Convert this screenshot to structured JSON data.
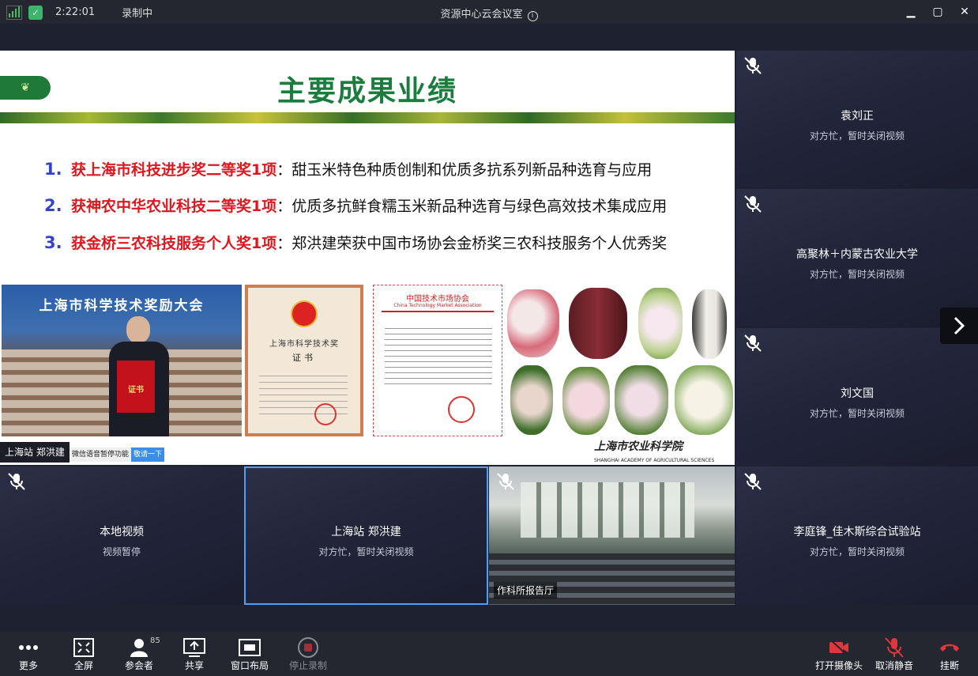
{
  "status_bar": {
    "time": "2:22:01",
    "recording": "录制中",
    "title": "资源中心云会议室",
    "info_icon": "info-icon"
  },
  "window_controls": [
    "minimize-icon",
    "maximize-icon",
    "close-icon"
  ],
  "shared_slide": {
    "title": "主要成果业绩",
    "achievements": [
      {
        "num": "1.",
        "award": "获上海市科技进步奖二等奖1项",
        "desc": "甜玉米特色种质创制和优质多抗系列新品种选育与应用"
      },
      {
        "num": "2.",
        "award": "获神农中华农业科技二等奖1项",
        "desc": "优质多抗鲜食糯玉米新品种选育与绿色高效技术集成应用"
      },
      {
        "num": "3.",
        "award": "获金桥三农科技服务个人奖1项",
        "desc": "郑洪建荣获中国市场协会金桥奖三农科技服务个人优秀奖"
      }
    ],
    "separator": "：",
    "photo_banner": "上海市科学技术奖励大会",
    "cert_in_hand": "证书",
    "cert1_heading": "上海市科学技术奖",
    "cert1_sub": "证书",
    "cert2_heading": "中国技术市场协会",
    "cert2_sub": "China Technology Market Association",
    "footer_logo": "上海市农业科学院",
    "footer_sub": "SHANGHAI ACADEMY OF AGRICULTURAL SCIENCES",
    "presenter_tag": "上海站 郑洪建",
    "subtitle_tag": "微信语音暂停功能",
    "subtitle_tag2": "敬请一下"
  },
  "tiles": [
    {
      "name": "袁刘正",
      "status": "对方忙，暂时关闭视频"
    },
    {
      "name": "高聚林＋内蒙古农业大学",
      "status": "对方忙，暂时关闭视频"
    },
    {
      "name": "刘文国",
      "status": "对方忙，暂时关闭视频"
    },
    {
      "name": "李庭锋_佳木斯综合试验站",
      "status": "对方忙，暂时关闭视频"
    },
    {
      "name": "本地视频",
      "status": "视频暂停"
    },
    {
      "name": "上海站 郑洪建",
      "status": "对方忙，暂时关闭视频"
    }
  ],
  "video_tile": {
    "label": "作科所报告厅"
  },
  "toolbar": {
    "more": "更多",
    "fullscreen": "全屏",
    "participants": "参会者",
    "participants_count": "85",
    "share": "共享",
    "layout": "窗口布局",
    "stop_record": "停止录制",
    "camera": "打开摄像头",
    "unmute": "取消静音",
    "hangup": "挂断"
  },
  "colors": {
    "accent_blue": "#4aa0ff",
    "slide_green": "#1a7d3e",
    "award_red": "#e0161e",
    "number_blue": "#3344cc",
    "hangup_red": "#e0363e"
  }
}
